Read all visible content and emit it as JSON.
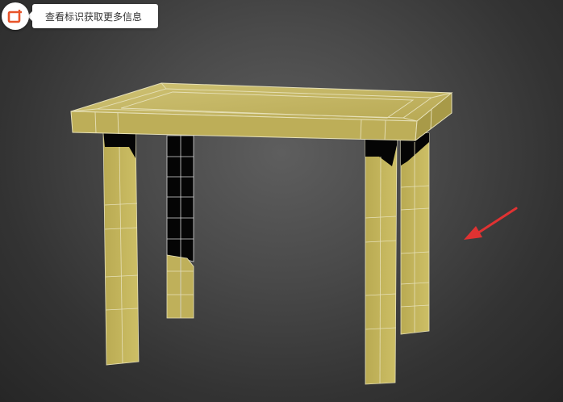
{
  "badge": {
    "label": "查看标识获取更多信息",
    "icon": "tag-icon",
    "icon_color": "#e8542a"
  },
  "scene": {
    "object": "table-model",
    "surface_color": "#c4b55a",
    "edge_color": "#e6e0b8",
    "background_color": "#3c3c3c",
    "annotation_arrow_color": "#e03232"
  }
}
